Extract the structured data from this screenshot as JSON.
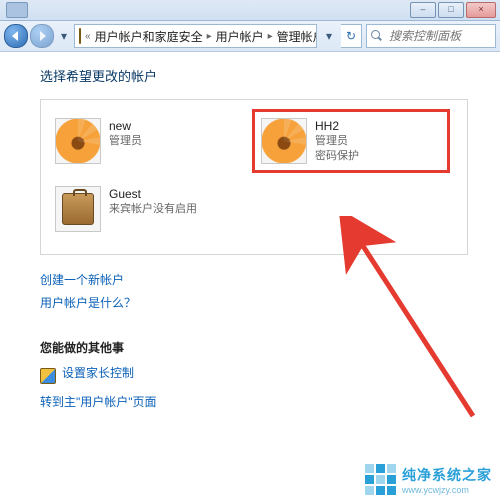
{
  "titlebar": {
    "min_tip": "–",
    "max_tip": "□",
    "close_tip": "×"
  },
  "breadcrumb": {
    "root_icon": "shield-icon",
    "level1": "用户帐户和家庭安全",
    "level2": "用户帐户",
    "level3": "管理帐户"
  },
  "search": {
    "placeholder": "搜索控制面板"
  },
  "heading": "选择希望更改的帐户",
  "accounts": [
    {
      "name": "new",
      "line1": "管理员",
      "line2": "",
      "icon": "flower",
      "selected": false
    },
    {
      "name": "HH2",
      "line1": "管理员",
      "line2": "密码保护",
      "icon": "flower",
      "selected": true
    },
    {
      "name": "Guest",
      "line1": "来宾帐户没有启用",
      "line2": "",
      "icon": "briefcase",
      "selected": false
    }
  ],
  "links": {
    "create": "创建一个新帐户",
    "what_is": "用户帐户是什么？"
  },
  "other": {
    "heading": "您能做的其他事",
    "parental": "设置家长控制",
    "goto_main": "转到主\"用户帐户\"页面"
  },
  "watermark": {
    "text": "纯净系统之家",
    "url": "www.ycwjzy.com"
  }
}
